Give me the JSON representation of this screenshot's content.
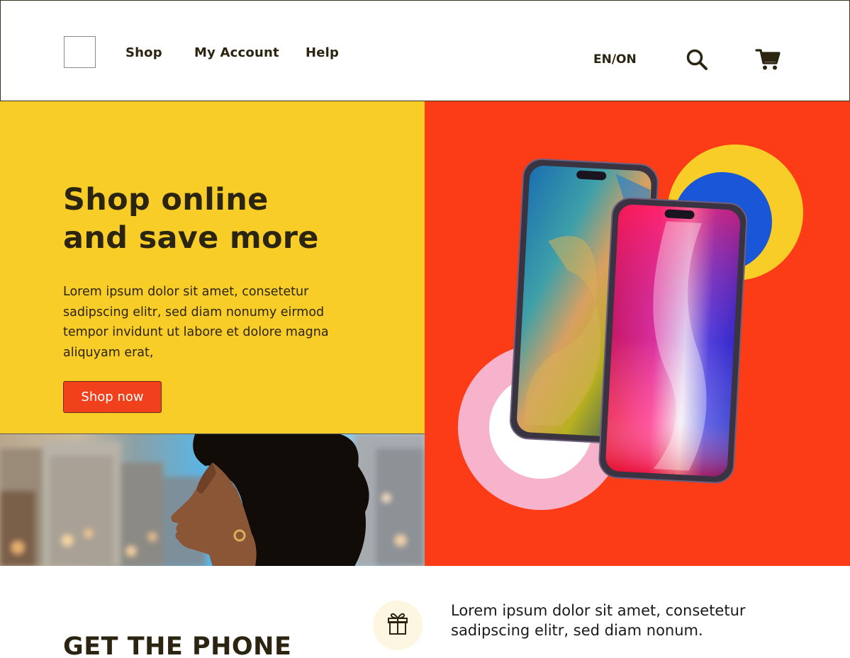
{
  "header": {
    "nav": {
      "shop": "Shop",
      "my_account": "My Account",
      "help": "Help"
    },
    "language": "EN/ON",
    "icons": {
      "logo": "logo-placeholder",
      "search": "search-icon",
      "cart": "cart-icon"
    }
  },
  "hero": {
    "title_line1": "Shop online",
    "title_line2": "and save more",
    "description": "Lorem ipsum dolor sit amet, consetetur sadipscing elitr, sed diam nonumy eirmod tempor invidunt ut labore et dolore magna aliquyam erat,",
    "cta_label": "Shop now",
    "colors": {
      "yellow": "#f9cd28",
      "red": "#fb3c17",
      "blue": "#1956d8",
      "pink": "#f6b3cb",
      "text": "#2b2410"
    }
  },
  "feature": {
    "icon": "gift-icon",
    "text": "Lorem ipsum dolor sit amet, consetetur sadipscing elitr, sed diam nonum."
  },
  "section": {
    "title": "GET THE PHONE"
  }
}
